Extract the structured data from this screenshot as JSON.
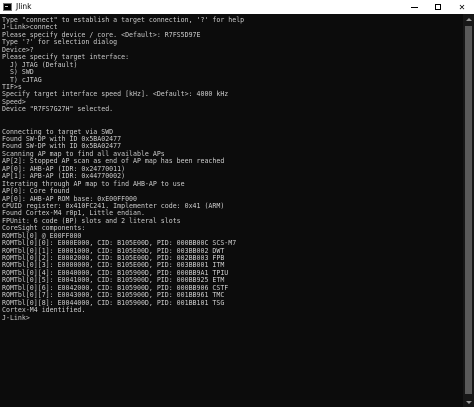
{
  "window": {
    "title": "Jlink",
    "icon": "console-app-icon",
    "controls": [
      "minimize-icon",
      "maximize-icon",
      "close-icon"
    ],
    "close_symbol": "✕"
  },
  "console": {
    "background": "#0c0c0c",
    "text_color": "#cccccc",
    "lines": [
      "Type \"connect\" to establish a target connection, '?' for help",
      "J-Link>connect",
      "Please specify device / core. <Default>: R7FS5D97E",
      "Type '?' for selection dialog",
      "Device>?",
      "Please specify target interface:",
      "  J) JTAG (Default)",
      "  S) SWD",
      "  T) cJTAG",
      "TIF>s",
      "Specify target interface speed [kHz]. <Default>: 4000 kHz",
      "Speed>",
      "Device \"R7FS7G27H\" selected.",
      "",
      "",
      "Connecting to target via SWD",
      "Found SW-DP with ID 0x5BA02477",
      "Found SW-DP with ID 0x5BA02477",
      "Scanning AP map to find all available APs",
      "AP[2]: Stopped AP scan as end of AP map has been reached",
      "AP[0]: AHB-AP (IDR: 0x24770011)",
      "AP[1]: APB-AP (IDR: 0x44770002)",
      "Iterating through AP map to find AHB-AP to use",
      "AP[0]: Core found",
      "AP[0]: AHB-AP ROM base: 0xE00FF000",
      "CPUID register: 0x410FC241. Implementer code: 0x41 (ARM)",
      "Found Cortex-M4 r0p1, Little endian.",
      "FPUnit: 6 code (BP) slots and 2 literal slots",
      "CoreSight components:",
      "ROMTbl[0] @ E00FF000",
      "ROMTbl[0][0]: E000E000, CID: B105E00D, PID: 000BB00C SCS-M7",
      "ROMTbl[0][1]: E0001000, CID: B105E00D, PID: 003BB002 DWT",
      "ROMTbl[0][2]: E0002000, CID: B105E00D, PID: 002BB003 FPB",
      "ROMTbl[0][3]: E0000000, CID: B105E00D, PID: 003BB001 ITM",
      "ROMTbl[0][4]: E0040000, CID: B105900D, PID: 000BB9A1 TPIU",
      "ROMTbl[0][5]: E0041000, CID: B105900D, PID: 000BB925 ETM",
      "ROMTbl[0][6]: E0042000, CID: B105900D, PID: 000BB906 CSTF",
      "ROMTbl[0][7]: E0043000, CID: B105900D, PID: 001BB961 TMC",
      "ROMTbl[0][8]: E0044000, CID: B105900D, PID: 001BB101 TSG",
      "Cortex-M4 identified.",
      "J-Link>"
    ]
  }
}
